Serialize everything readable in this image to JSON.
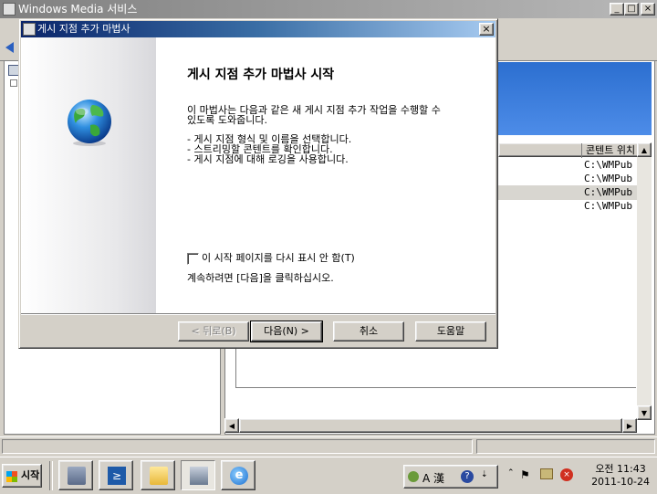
{
  "main_window": {
    "title": "Windows Media 서비스",
    "min_glyph": "_",
    "max_glyph": "□",
    "close_glyph": "×"
  },
  "content_list": {
    "column_header": "콘텐트 위치",
    "rows": [
      "C:\\WMPub",
      "C:\\WMPub",
      "C:\\WMPub",
      "C:\\WMPub"
    ]
  },
  "dialog": {
    "title": "게시 지점 추가 마법사",
    "close_glyph": "×",
    "heading": "게시 지점 추가 마법사 시작",
    "intro_line1": "이 마법사는 다음과 같은 새 게시 지점 추가 작업을 수행할 수",
    "intro_line2": "있도록 도와줍니다.",
    "tasks": [
      "- 게시 지점 형식 및 이름을 선택합니다.",
      "- 스트리밍할 콘텐트를 확인합니다.",
      "- 게시 지점에 대해 로깅을 사용합니다."
    ],
    "checkbox_label": "이 시작 페이지를 다시 표시 안 함(T)",
    "continue_text": "계속하려면 [다음]을 클릭하십시오.",
    "buttons": {
      "back": "< 뒤로(B)",
      "next": "다음(N) >",
      "cancel": "취소",
      "help": "도움말"
    }
  },
  "taskbar": {
    "start_label": "시작",
    "ime_label": "A 漢",
    "clock_time": "오전 11:43",
    "clock_date": "2011-10-24"
  },
  "colors": {
    "dialog_title_start": "#0a246a",
    "dialog_title_end": "#a6caf0",
    "banner_blue": "#2c6fd0"
  }
}
